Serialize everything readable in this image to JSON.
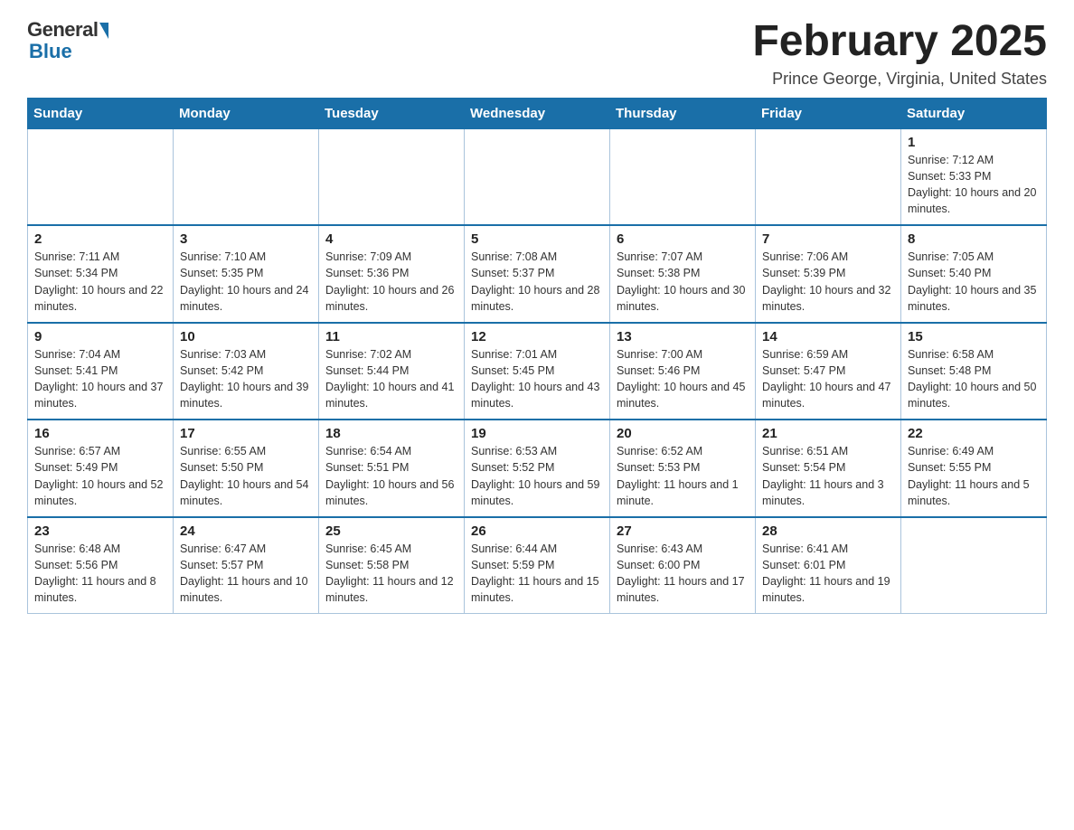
{
  "header": {
    "logo_general": "General",
    "logo_blue": "Blue",
    "month_title": "February 2025",
    "location": "Prince George, Virginia, United States"
  },
  "days_of_week": [
    "Sunday",
    "Monday",
    "Tuesday",
    "Wednesday",
    "Thursday",
    "Friday",
    "Saturday"
  ],
  "weeks": [
    [
      {
        "day": "",
        "info": ""
      },
      {
        "day": "",
        "info": ""
      },
      {
        "day": "",
        "info": ""
      },
      {
        "day": "",
        "info": ""
      },
      {
        "day": "",
        "info": ""
      },
      {
        "day": "",
        "info": ""
      },
      {
        "day": "1",
        "info": "Sunrise: 7:12 AM\nSunset: 5:33 PM\nDaylight: 10 hours and 20 minutes."
      }
    ],
    [
      {
        "day": "2",
        "info": "Sunrise: 7:11 AM\nSunset: 5:34 PM\nDaylight: 10 hours and 22 minutes."
      },
      {
        "day": "3",
        "info": "Sunrise: 7:10 AM\nSunset: 5:35 PM\nDaylight: 10 hours and 24 minutes."
      },
      {
        "day": "4",
        "info": "Sunrise: 7:09 AM\nSunset: 5:36 PM\nDaylight: 10 hours and 26 minutes."
      },
      {
        "day": "5",
        "info": "Sunrise: 7:08 AM\nSunset: 5:37 PM\nDaylight: 10 hours and 28 minutes."
      },
      {
        "day": "6",
        "info": "Sunrise: 7:07 AM\nSunset: 5:38 PM\nDaylight: 10 hours and 30 minutes."
      },
      {
        "day": "7",
        "info": "Sunrise: 7:06 AM\nSunset: 5:39 PM\nDaylight: 10 hours and 32 minutes."
      },
      {
        "day": "8",
        "info": "Sunrise: 7:05 AM\nSunset: 5:40 PM\nDaylight: 10 hours and 35 minutes."
      }
    ],
    [
      {
        "day": "9",
        "info": "Sunrise: 7:04 AM\nSunset: 5:41 PM\nDaylight: 10 hours and 37 minutes."
      },
      {
        "day": "10",
        "info": "Sunrise: 7:03 AM\nSunset: 5:42 PM\nDaylight: 10 hours and 39 minutes."
      },
      {
        "day": "11",
        "info": "Sunrise: 7:02 AM\nSunset: 5:44 PM\nDaylight: 10 hours and 41 minutes."
      },
      {
        "day": "12",
        "info": "Sunrise: 7:01 AM\nSunset: 5:45 PM\nDaylight: 10 hours and 43 minutes."
      },
      {
        "day": "13",
        "info": "Sunrise: 7:00 AM\nSunset: 5:46 PM\nDaylight: 10 hours and 45 minutes."
      },
      {
        "day": "14",
        "info": "Sunrise: 6:59 AM\nSunset: 5:47 PM\nDaylight: 10 hours and 47 minutes."
      },
      {
        "day": "15",
        "info": "Sunrise: 6:58 AM\nSunset: 5:48 PM\nDaylight: 10 hours and 50 minutes."
      }
    ],
    [
      {
        "day": "16",
        "info": "Sunrise: 6:57 AM\nSunset: 5:49 PM\nDaylight: 10 hours and 52 minutes."
      },
      {
        "day": "17",
        "info": "Sunrise: 6:55 AM\nSunset: 5:50 PM\nDaylight: 10 hours and 54 minutes."
      },
      {
        "day": "18",
        "info": "Sunrise: 6:54 AM\nSunset: 5:51 PM\nDaylight: 10 hours and 56 minutes."
      },
      {
        "day": "19",
        "info": "Sunrise: 6:53 AM\nSunset: 5:52 PM\nDaylight: 10 hours and 59 minutes."
      },
      {
        "day": "20",
        "info": "Sunrise: 6:52 AM\nSunset: 5:53 PM\nDaylight: 11 hours and 1 minute."
      },
      {
        "day": "21",
        "info": "Sunrise: 6:51 AM\nSunset: 5:54 PM\nDaylight: 11 hours and 3 minutes."
      },
      {
        "day": "22",
        "info": "Sunrise: 6:49 AM\nSunset: 5:55 PM\nDaylight: 11 hours and 5 minutes."
      }
    ],
    [
      {
        "day": "23",
        "info": "Sunrise: 6:48 AM\nSunset: 5:56 PM\nDaylight: 11 hours and 8 minutes."
      },
      {
        "day": "24",
        "info": "Sunrise: 6:47 AM\nSunset: 5:57 PM\nDaylight: 11 hours and 10 minutes."
      },
      {
        "day": "25",
        "info": "Sunrise: 6:45 AM\nSunset: 5:58 PM\nDaylight: 11 hours and 12 minutes."
      },
      {
        "day": "26",
        "info": "Sunrise: 6:44 AM\nSunset: 5:59 PM\nDaylight: 11 hours and 15 minutes."
      },
      {
        "day": "27",
        "info": "Sunrise: 6:43 AM\nSunset: 6:00 PM\nDaylight: 11 hours and 17 minutes."
      },
      {
        "day": "28",
        "info": "Sunrise: 6:41 AM\nSunset: 6:01 PM\nDaylight: 11 hours and 19 minutes."
      },
      {
        "day": "",
        "info": ""
      }
    ]
  ]
}
